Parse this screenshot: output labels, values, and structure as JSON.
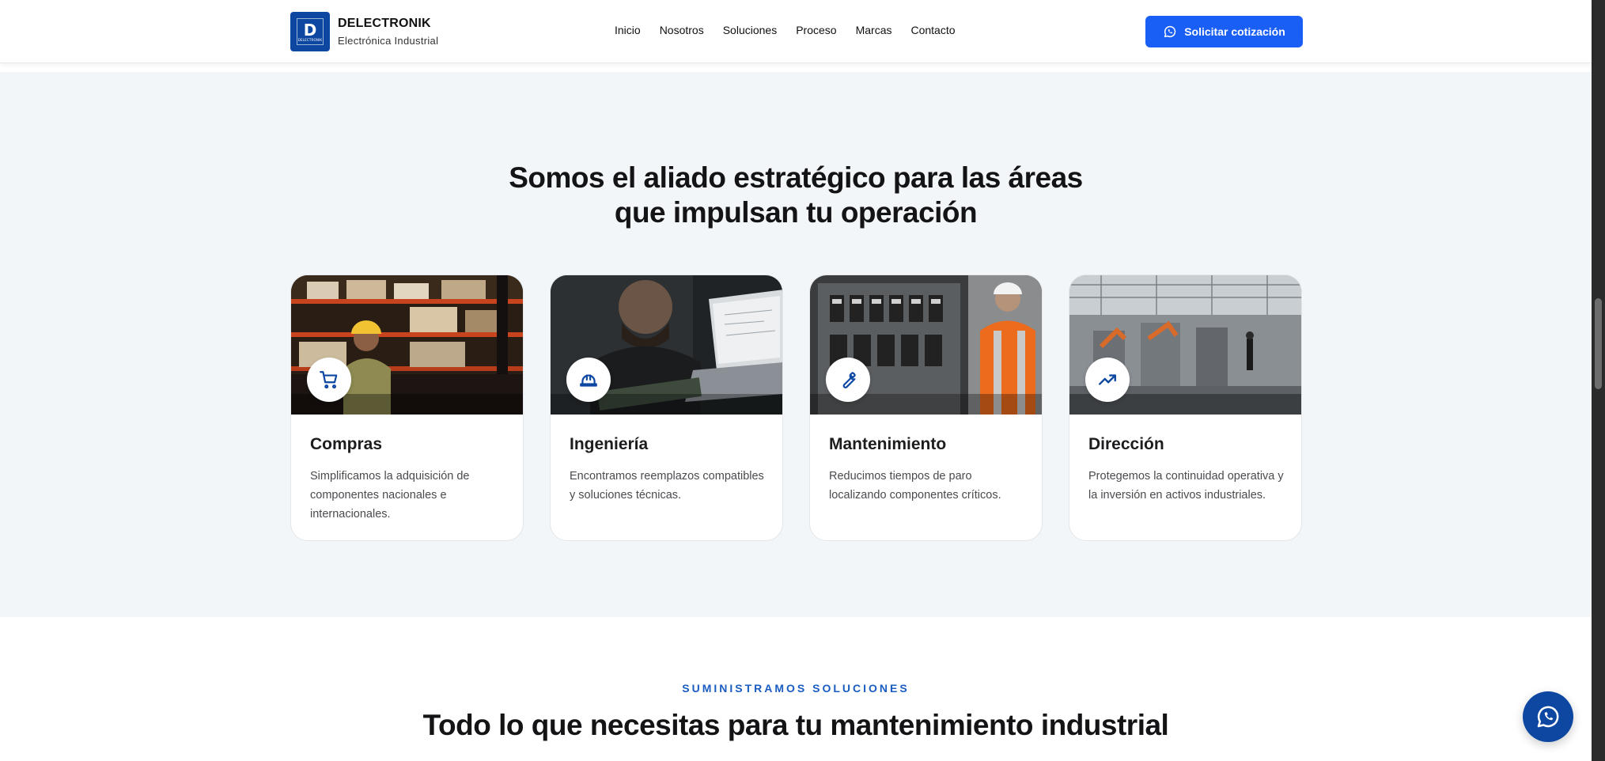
{
  "header": {
    "brand_name": "DELECTRONIK",
    "brand_sub": "Electrónica Industrial",
    "logo_letter": "D",
    "logo_mini": "DELECTRONIK",
    "nav": [
      "Inicio",
      "Nosotros",
      "Soluciones",
      "Proceso",
      "Marcas",
      "Contacto"
    ],
    "cta_label": "Solicitar cotización",
    "cta_icon": "whatsapp-icon"
  },
  "areas": {
    "title_line1": "Somos el aliado estratégico para las áreas",
    "title_line2": "que impulsan tu operación",
    "cards": [
      {
        "title": "Compras",
        "desc": "Simplificamos la adquisición de componentes nacionales e internacionales.",
        "icon": "cart-icon"
      },
      {
        "title": "Ingeniería",
        "desc": "Encontramos reemplazos compatibles y soluciones técnicas.",
        "icon": "hard-hat-icon"
      },
      {
        "title": "Mantenimiento",
        "desc": "Reducimos tiempos de paro localizando componentes críticos.",
        "icon": "wrench-icon"
      },
      {
        "title": "Dirección",
        "desc": "Protegemos la continuidad operativa y la inversión en activos industriales.",
        "icon": "trending-up-icon"
      }
    ]
  },
  "solutions": {
    "eyebrow": "SUMINISTRAMOS SOLUCIONES",
    "title": "Todo lo que necesitas para tu mantenimiento industrial"
  },
  "colors": {
    "brand_blue": "#0d47a1",
    "cta_blue": "#1a5ff5",
    "section_bg": "#f3f6f9"
  }
}
